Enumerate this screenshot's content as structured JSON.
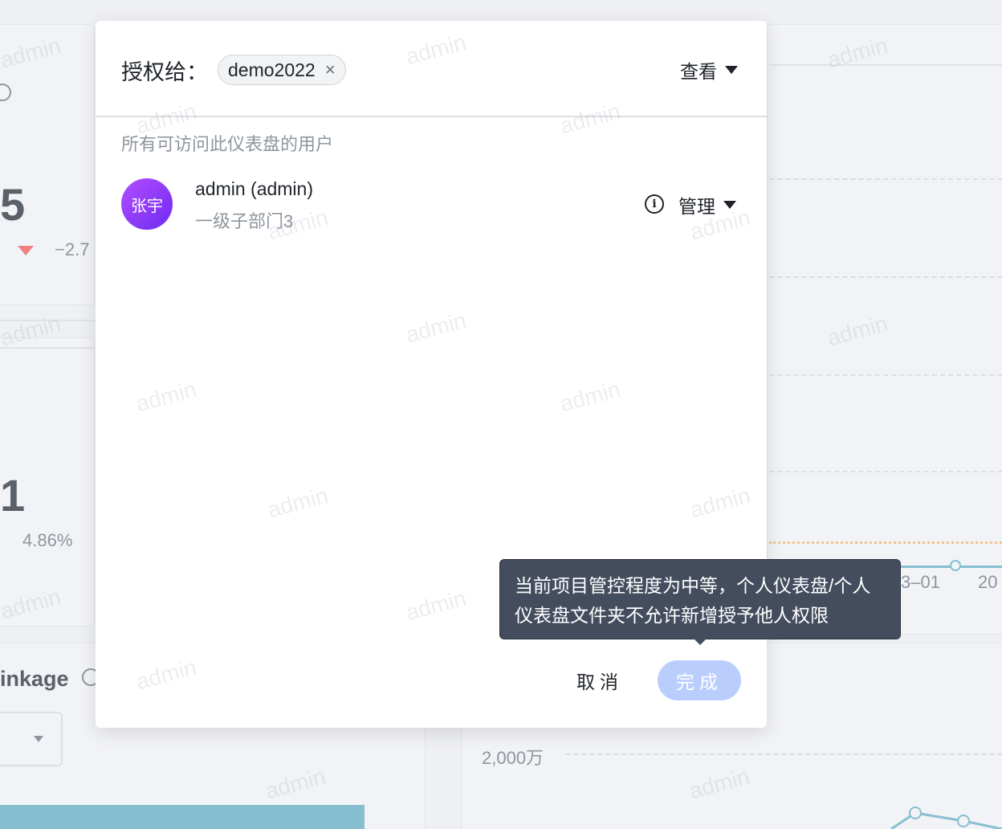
{
  "background": {
    "metric_1_value": "5",
    "metric_1_change": "−2.7",
    "metric_2_value": "1",
    "metric_2_change": "4.86%",
    "linkage_label": "inkage",
    "axis_tick_1": "3–01",
    "axis_tick_2": "20",
    "axis_value": "2,000万",
    "watermark_text": "admin"
  },
  "dialog": {
    "grant_label": "授权给：",
    "grantee_chip": "demo2022",
    "chip_close": "×",
    "permission_value": "查看",
    "section_title": "所有可访问此仪表盘的用户",
    "users": [
      {
        "avatar_text": "张宇",
        "name": "admin (admin)",
        "department": "一级子部门3",
        "role": "管理"
      }
    ],
    "cancel_label": "取消",
    "done_label": "完成"
  },
  "tooltip": {
    "text": "当前项目管控程度为中等，个人仪表盘/个人仪表盘文件夹不允许新增授予他人权限"
  },
  "colors": {
    "primary_disabled": "#bacefd",
    "avatar_gradient_start": "#b34dff",
    "avatar_gradient_end": "#6e2bf2",
    "tooltip_bg": "#444d5e"
  }
}
